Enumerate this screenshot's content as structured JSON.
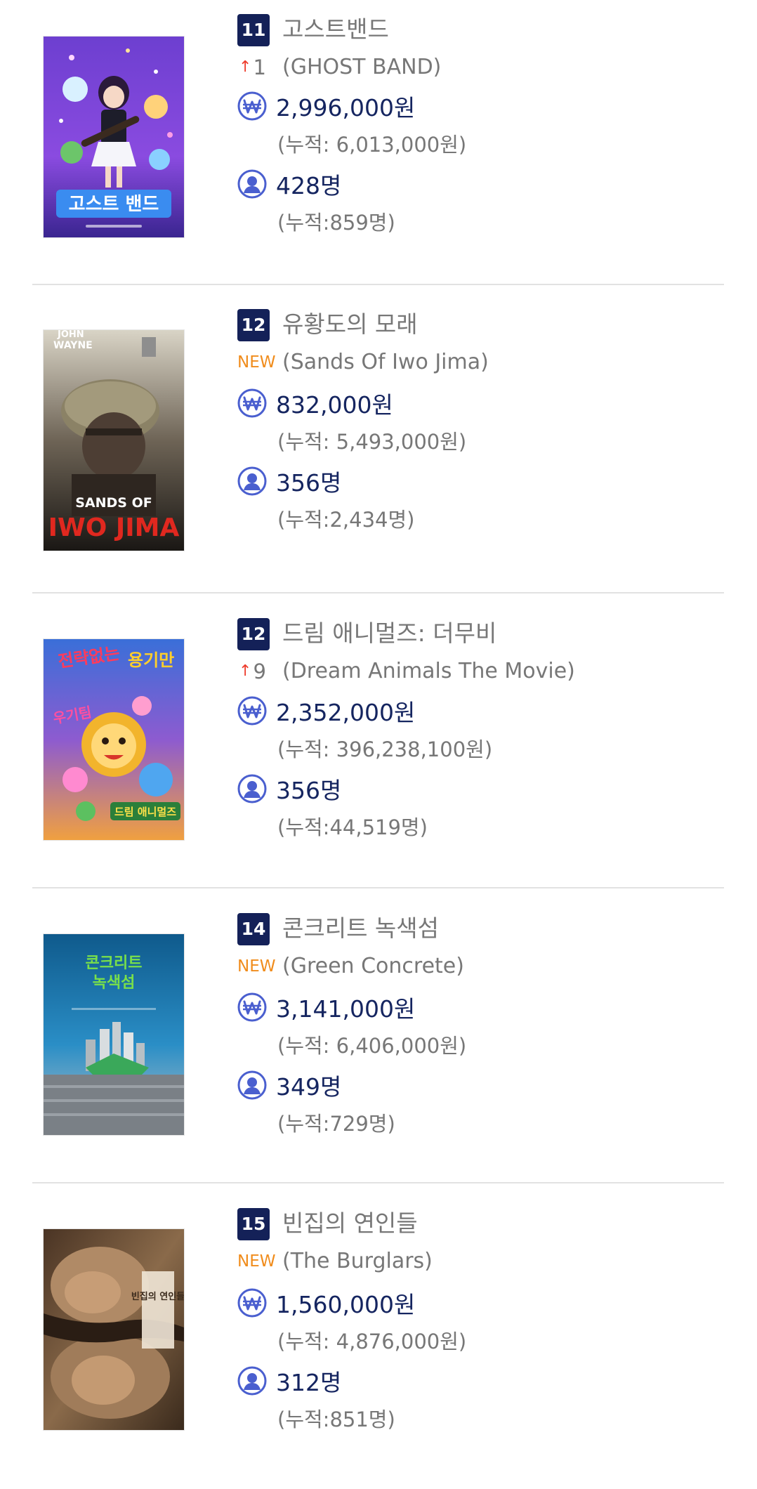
{
  "colors": {
    "rank_badge_bg": "#142158",
    "rank_up_arrow": "#ee3b2b",
    "new_badge": "#f08c1c",
    "stat_icon": "#4a5fcf",
    "stat_value": "#152560",
    "secondary_text": "#777777",
    "divider": "#e2e2e2"
  },
  "movies": [
    {
      "rank": "11",
      "title_ko": "고스트밴드",
      "change_type": "up",
      "change_arrow": "↑",
      "change_value": "1",
      "title_en": "(GHOST BAND)",
      "sales": "2,996,000원",
      "sales_cumulative": "(누적: 6,013,000원)",
      "audience": "428명",
      "audience_cumulative": "(누적:859명)",
      "poster_icon": "poster-ghost-band",
      "poster_text": "고스트 밴드"
    },
    {
      "rank": "12",
      "title_ko": "유황도의 모래",
      "change_type": "new",
      "change_label": "NEW",
      "title_en": "(Sands Of Iwo Jima)",
      "sales": "832,000원",
      "sales_cumulative": "(누적: 5,493,000원)",
      "audience": "356명",
      "audience_cumulative": "(누적:2,434명)",
      "poster_icon": "poster-sands-of-iwo-jima",
      "poster_text_top_1": "JOHN",
      "poster_text_top_2": "WAYNE",
      "poster_text_mid": "SANDS OF",
      "poster_text_bottom": "IWO JIMA"
    },
    {
      "rank": "12",
      "title_ko": "드림 애니멀즈: 더무비",
      "change_type": "up",
      "change_arrow": "↑",
      "change_value": "9",
      "title_en": "(Dream Animals The Movie)",
      "sales": "2,352,000원",
      "sales_cumulative": "(누적: 396,238,100원)",
      "audience": "356명",
      "audience_cumulative": "(누적:44,519명)",
      "poster_icon": "poster-dream-animals",
      "poster_text_left": "전략없는",
      "poster_text_right": "용기만",
      "poster_text_left2": "우기팀",
      "poster_text_bottom": "드림 애니멀즈"
    },
    {
      "rank": "14",
      "title_ko": "콘크리트 녹색섬",
      "change_type": "new",
      "change_label": "NEW",
      "title_en": "(Green Concrete)",
      "sales": "3,141,000원",
      "sales_cumulative": "(누적: 6,406,000원)",
      "audience": "349명",
      "audience_cumulative": "(누적:729명)",
      "poster_icon": "poster-green-concrete",
      "poster_text_1": "콘크리트",
      "poster_text_2": "녹색섬"
    },
    {
      "rank": "15",
      "title_ko": "빈집의 연인들",
      "change_type": "new",
      "change_label": "NEW",
      "title_en": "(The Burglars)",
      "sales": "1,560,000원",
      "sales_cumulative": "(누적: 4,876,000원)",
      "audience": "312명",
      "audience_cumulative": "(누적:851명)",
      "poster_icon": "poster-the-burglars",
      "poster_text": "빈집의 연인들"
    }
  ]
}
